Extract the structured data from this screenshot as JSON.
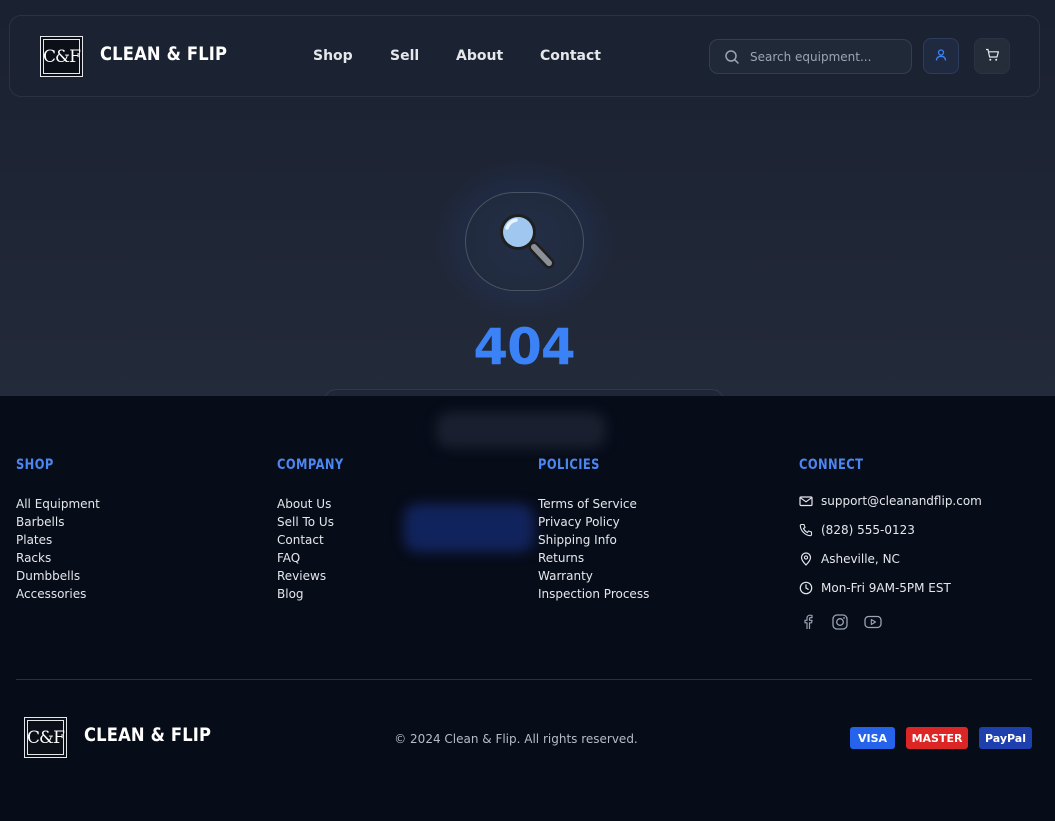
{
  "header": {
    "logo_text": "C&F",
    "brand": "CLEAN & FLIP",
    "nav": [
      "Shop",
      "Sell",
      "About",
      "Contact"
    ],
    "search_placeholder": "Search equipment...",
    "icons": [
      "search-icon",
      "user-icon",
      "cart-icon"
    ]
  },
  "hero": {
    "icon": "magnifying-glass-icon",
    "code": "404"
  },
  "footer": {
    "shop": {
      "heading": "SHOP",
      "links": [
        "All Equipment",
        "Barbells",
        "Plates",
        "Racks",
        "Dumbbells",
        "Accessories"
      ]
    },
    "company": {
      "heading": "COMPANY",
      "links": [
        "About Us",
        "Sell To Us",
        "Contact",
        "FAQ",
        "Reviews",
        "Blog"
      ]
    },
    "policies": {
      "heading": "POLICIES",
      "links": [
        "Terms of Service",
        "Privacy Policy",
        "Shipping Info",
        "Returns",
        "Warranty",
        "Inspection Process"
      ]
    },
    "connect": {
      "heading": "CONNECT",
      "email": "support@cleanandflip.com",
      "phone": "(828) 555-0123",
      "location": "Asheville, NC",
      "hours": "Mon-Fri 9AM-5PM EST",
      "socials": [
        "facebook-icon",
        "instagram-icon",
        "youtube-icon"
      ]
    },
    "bottom": {
      "brand": "CLEAN & FLIP",
      "copyright": "© 2024 Clean & Flip. All rights reserved.",
      "payments": [
        {
          "label": "VISA",
          "color": "#2563eb"
        },
        {
          "label": "MASTER",
          "color": "#dc2626"
        },
        {
          "label": "PayPal",
          "color": "#1e40af"
        }
      ]
    }
  }
}
